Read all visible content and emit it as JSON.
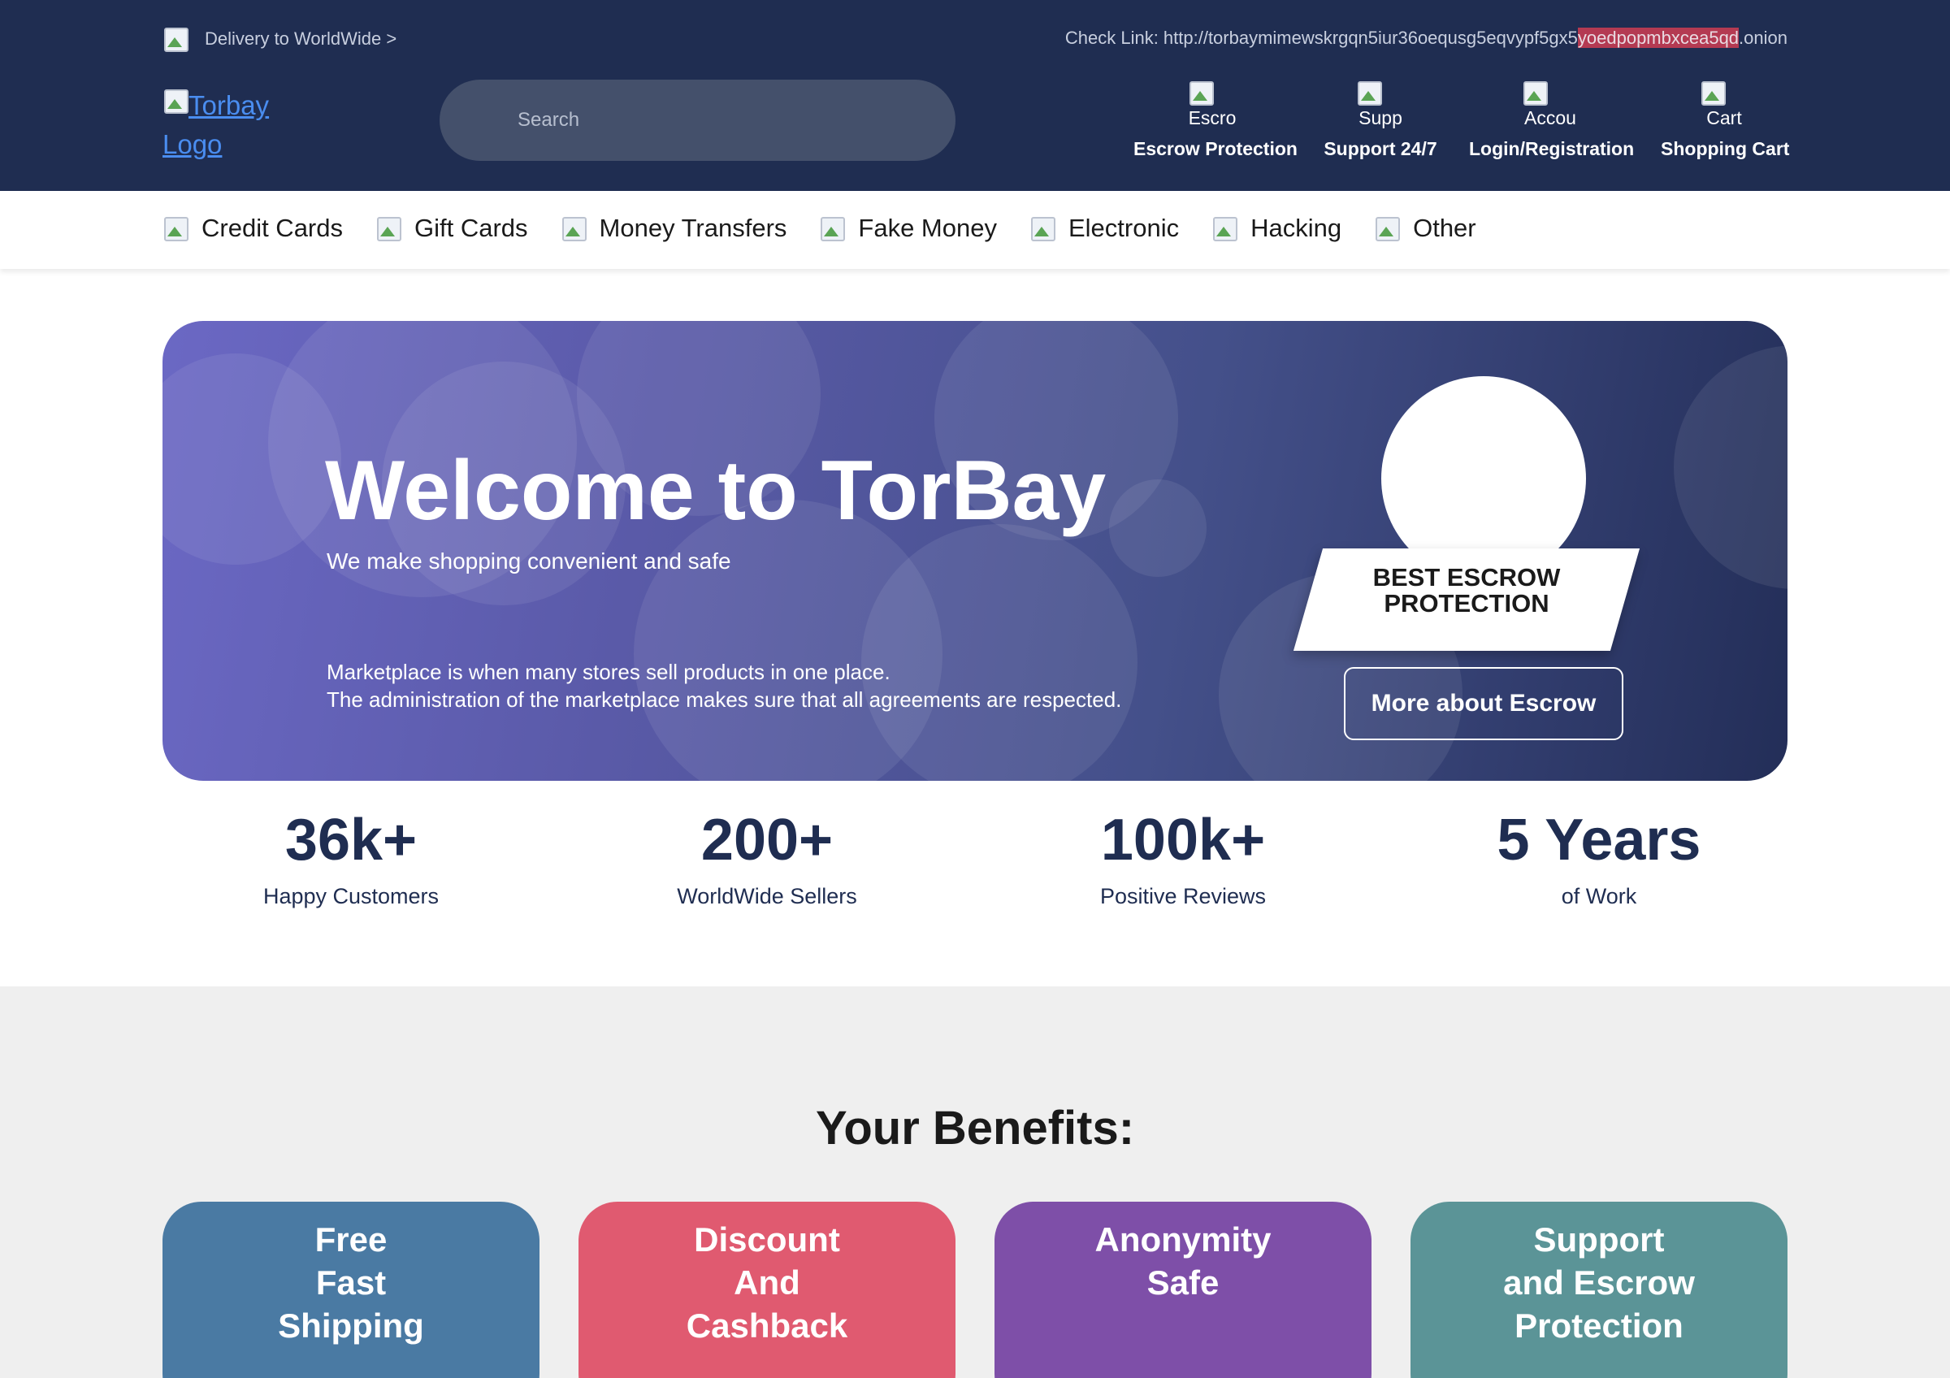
{
  "header": {
    "delivery_text": "Delivery to WorldWide >",
    "check_link_prefix": "Check Link: http://torbaymimewskrgqn5iur36oequsg5eqvypf5gx5",
    "check_link_highlight": "yoedpopmbxcea5qd",
    "check_link_suffix": ".onion",
    "logo_alt": "Torbay Logo",
    "search_placeholder": "Search",
    "nav": [
      {
        "alt": "Escro",
        "label": "Escrow Protection"
      },
      {
        "alt": "Supp",
        "label": "Support 24/7"
      },
      {
        "alt": "Accou",
        "label": "Login/Registration"
      },
      {
        "alt": "Cart",
        "label": "Shopping Cart"
      }
    ]
  },
  "categories": [
    "Credit Cards",
    "Gift Cards",
    "Money Transfers",
    "Fake Money",
    "Electronic",
    "Hacking",
    "Other"
  ],
  "hero": {
    "title": "Welcome to TorBay",
    "subtitle": "We make shopping convenient and safe",
    "desc_line1": "Marketplace is when many stores sell products in one place.",
    "desc_line2": "The administration of the marketplace makes sure that all agreements are respected.",
    "badge_line1": "BEST ESCROW",
    "badge_line2": "PROTECTION",
    "button": "More about Escrow"
  },
  "stats": [
    {
      "value": "36k+",
      "label": "Happy Customers"
    },
    {
      "value": "200+",
      "label": "WorldWide Sellers"
    },
    {
      "value": "100k+",
      "label": "Positive Reviews"
    },
    {
      "value": "5 Years",
      "label": "of Work"
    }
  ],
  "benefits": {
    "title": "Your Benefits:",
    "cards": [
      {
        "lines": [
          "Free",
          "Fast",
          "Shipping"
        ],
        "color": "#4a7aa3"
      },
      {
        "lines": [
          "Discount",
          "And",
          "Cashback"
        ],
        "color": "#e05a70"
      },
      {
        "lines": [
          "Anonymity",
          "Safe",
          ""
        ],
        "color": "#7e4fa8"
      },
      {
        "lines": [
          "Support",
          "and Escrow",
          "Protection"
        ],
        "color": "#5b9497"
      }
    ]
  },
  "colors": {
    "header_bg": "#1f2d51",
    "accent_highlight": "#b43a52",
    "text_dark": "#1f2d51"
  }
}
